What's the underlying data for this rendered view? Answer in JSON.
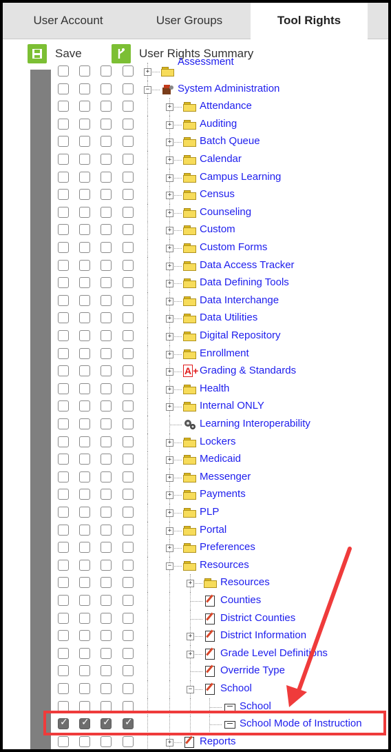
{
  "tabs": [
    {
      "label": "User Account",
      "active": false
    },
    {
      "label": "User Groups",
      "active": false
    },
    {
      "label": "Tool Rights",
      "active": true
    }
  ],
  "toolbar": {
    "save_label": "Save",
    "summary_label": "User Rights Summary",
    "accent_color": "#7cbf34"
  },
  "tree": {
    "partial_top_label": "Assessment",
    "root_label": "System Administration",
    "children": [
      "Attendance",
      "Auditing",
      "Batch Queue",
      "Calendar",
      "Campus Learning",
      "Census",
      "Counseling",
      "Custom",
      "Custom Forms",
      "Data Access Tracker",
      "Data Defining Tools",
      "Data Interchange",
      "Data Utilities",
      "Digital Repository",
      "Enrollment",
      "Grading & Standards",
      "Health",
      "Internal ONLY",
      "Learning Interoperability",
      "Lockers",
      "Medicaid",
      "Messenger",
      "Payments",
      "PLP",
      "Portal",
      "Preferences",
      "Resources"
    ],
    "resources_children": [
      "Resources",
      "Counties",
      "District Counties",
      "District Information",
      "Grade Level Definitions",
      "Override Type",
      "School"
    ],
    "school_children": [
      "School",
      "School Mode of Instruction"
    ],
    "next_sibling": "Reports"
  },
  "highlight_color": "#ef3b3b",
  "link_color": "#1d1ded"
}
